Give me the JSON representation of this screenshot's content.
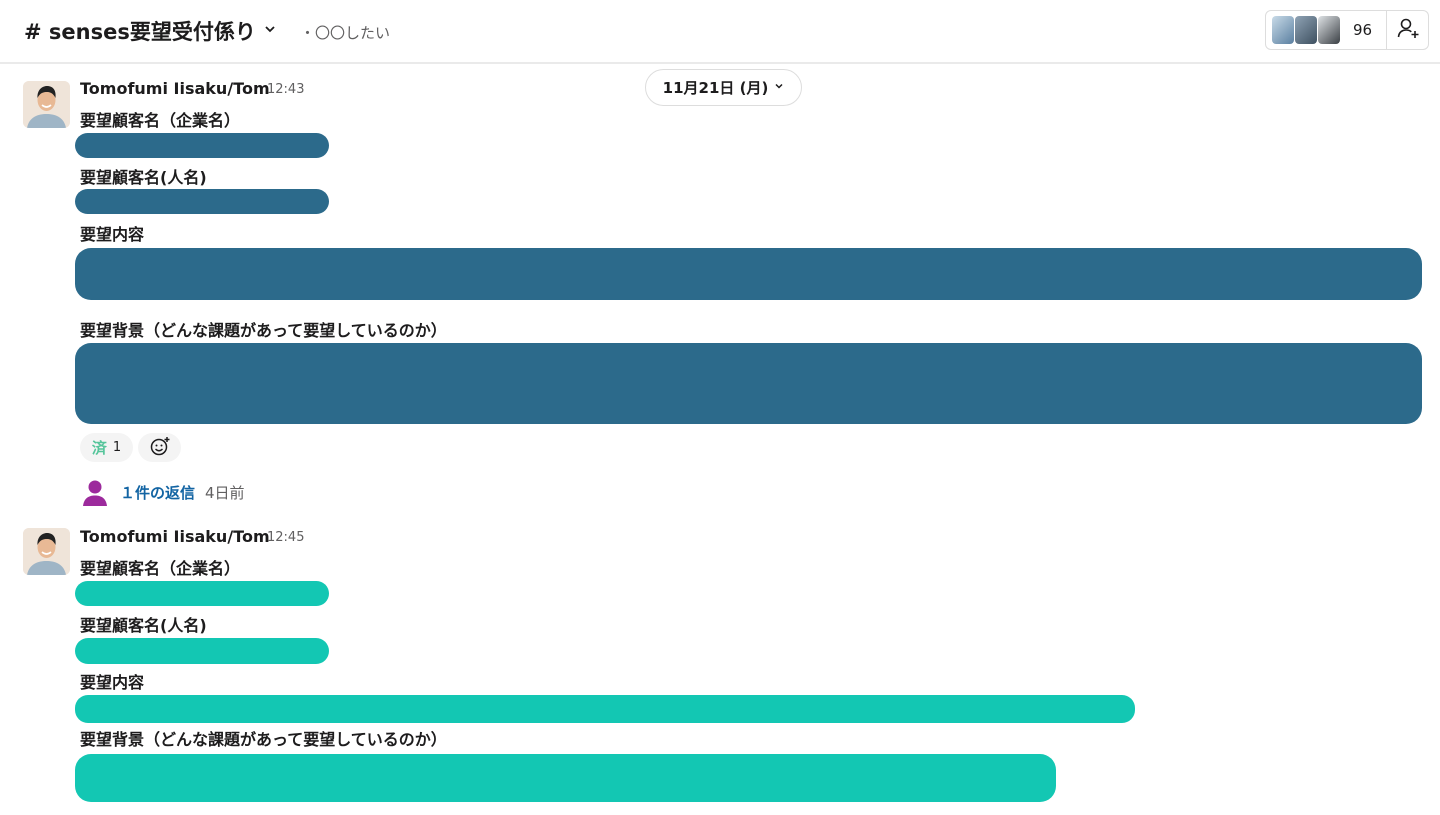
{
  "channel": {
    "name": "# senses要望受付係り",
    "topic": "・〇〇したい",
    "member_count": "96"
  },
  "date_divider": {
    "label": "11月21日 (月)"
  },
  "messages": [
    {
      "author": "Tomofumi Iisaku/Tom",
      "time": "12:43",
      "fields": [
        "要望顧客名（企業名）",
        "要望顧客名(人名)",
        "要望内容",
        "要望背景（どんな課題があって要望しているのか）"
      ],
      "redaction_color": "#2c6a8b",
      "reaction": {
        "emoji_name": "済-emoji",
        "emoji": "済",
        "count": "1"
      },
      "thread": {
        "replies_label": "１件の返信",
        "time": "4日前"
      }
    },
    {
      "author": "Tomofumi Iisaku/Tom",
      "time": "12:45",
      "fields": [
        "要望顧客名（企業名）",
        "要望顧客名(人名)",
        "要望内容",
        "要望背景（どんな課題があって要望しているのか）"
      ],
      "redaction_color": "#13c7b3"
    }
  ],
  "icons": {
    "channel_chevron": "chevron-down-icon",
    "add_member": "add-person-icon",
    "add_reaction": "add-reaction-icon",
    "reply_avatar": "person-icon"
  }
}
